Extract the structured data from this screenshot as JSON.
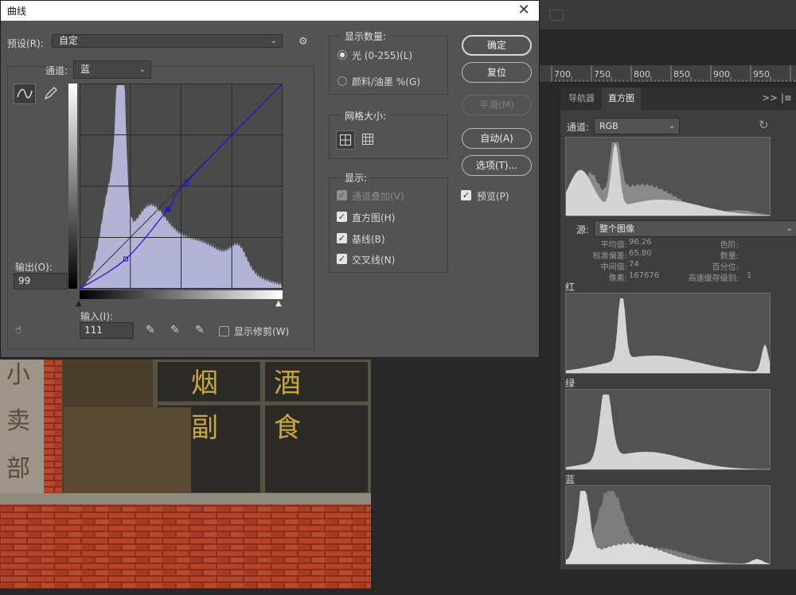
{
  "dialog": {
    "title": "曲线",
    "close_symbol": "✕",
    "preset_label": "预设(R):",
    "preset_value": "自定",
    "channel_label": "通道:",
    "channel_value": "蓝",
    "output_label": "输出(O):",
    "output_value": "99",
    "input_label": "输入(I):",
    "input_value": "111",
    "show_clipping_label": "显示修剪(W)",
    "show_amount": {
      "title": "显示数量:",
      "option_light": "光 (0-255)(L)",
      "option_pigment": "颜料/油墨 %(G)",
      "selected": "light"
    },
    "grid_size": {
      "title": "网格大小:"
    },
    "show": {
      "title": "显示:",
      "options": [
        {
          "label": "通道叠加(V)",
          "checked": true,
          "disabled": true
        },
        {
          "label": "直方图(H)",
          "checked": true
        },
        {
          "label": "基线(B)",
          "checked": true
        },
        {
          "label": "交叉线(N)",
          "checked": true
        }
      ]
    },
    "buttons": {
      "ok": "确定",
      "reset": "复位",
      "smooth": "平滑(M)",
      "auto": "自动(A)",
      "options": "选项(T)..."
    },
    "preview_label": "预览(P)",
    "preview_checked": true,
    "checkmark": "✓",
    "curve_points": [
      [
        0,
        0
      ],
      [
        58,
        37
      ],
      [
        111,
        99
      ],
      [
        134,
        132
      ],
      [
        255,
        255
      ]
    ],
    "colors": {
      "curve": "#1a1ad8",
      "histogram": "#b3b3d6",
      "graph_bg": "#4a4a4a"
    }
  },
  "workspace": {
    "ruler_ticks": [
      "700",
      "750",
      "800",
      "850",
      "900",
      "950"
    ]
  },
  "histogram_panel": {
    "tabs": [
      "导航器",
      "直方图"
    ],
    "active_tab": "直方图",
    "menu_symbol": ">> |≡",
    "channel_label": "通道:",
    "channel_value": "RGB",
    "source_label": "源:",
    "source_value": "整个图像",
    "stats_left": [
      {
        "label": "平均值:",
        "value": "96.26"
      },
      {
        "label": "标准偏差:",
        "value": "65.80"
      },
      {
        "label": "中间值:",
        "value": "74"
      },
      {
        "label": "像素:",
        "value": "167676"
      }
    ],
    "stats_right": [
      {
        "label": "色阶:",
        "value": ""
      },
      {
        "label": "数量:",
        "value": ""
      },
      {
        "label": "百分位:",
        "value": ""
      },
      {
        "label": "高速缓存级别:",
        "value": "1"
      }
    ],
    "channel_labels": [
      "红",
      "绿",
      "蓝"
    ],
    "refresh_symbol": "↻"
  },
  "photo": {
    "sign_right": [
      "烟",
      "副",
      "酒",
      "食"
    ],
    "sign_left": [
      "小",
      "卖",
      "部"
    ]
  }
}
